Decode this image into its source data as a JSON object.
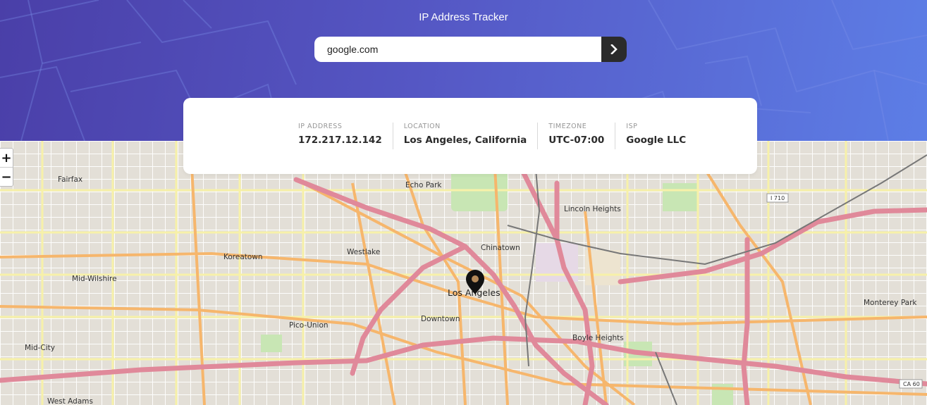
{
  "header": {
    "title": "IP Address Tracker",
    "search_value": "google.com",
    "search_button_icon": "chevron-right-icon"
  },
  "info": {
    "ip_label": "IP ADDRESS",
    "ip_value": "172.217.12.142",
    "location_label": "LOCATION",
    "location_value": "Los Angeles, California",
    "timezone_label": "TIMEZONE",
    "timezone_value": "UTC-07:00",
    "isp_label": "ISP",
    "isp_value": "Google LLC"
  },
  "map": {
    "zoom_in": "+",
    "zoom_out": "−",
    "marker_icon": "location-pin-icon",
    "places": {
      "fairfax": "Fairfax",
      "echo_park": "Echo Park",
      "lincoln_heights": "Lincoln Heights",
      "chinatown": "Chinatown",
      "westlake": "Westlake",
      "koreatown": "Koreatown",
      "mid_wilshire": "Mid-Wilshire",
      "los_angeles": "Los Angeles",
      "downtown": "Downtown",
      "pico_union": "Pico-Union",
      "boyle_heights": "Boyle Heights",
      "monterey_park": "Monterey Park",
      "mid_city": "Mid-City",
      "west_adams": "West Adams",
      "i710": "I 710",
      "ca60": "CA 60"
    },
    "colors": {
      "land": "#f2efe9",
      "freeway": "#e892a2",
      "trunk": "#f9b27a",
      "street": "#fdfcd0"
    }
  }
}
